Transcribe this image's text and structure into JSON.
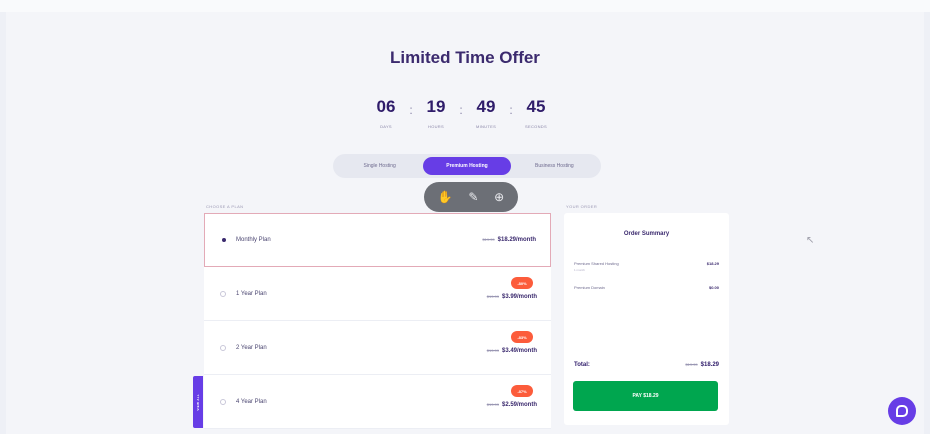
{
  "header": {
    "title": "Limited Time Offer"
  },
  "timer": {
    "blocks": [
      {
        "value": "06",
        "label": "DAYS"
      },
      {
        "value": "19",
        "label": "HOURS"
      },
      {
        "value": "49",
        "label": "MINUTES"
      },
      {
        "value": "45",
        "label": "SECONDS"
      }
    ],
    "separator": ":"
  },
  "tabs": [
    {
      "label": "Single Hosting",
      "active": false
    },
    {
      "label": "Premium Hosting",
      "active": true
    },
    {
      "label": "Business Hosting",
      "active": false
    }
  ],
  "widget": {
    "icons": [
      "hand-icon",
      "magic-wand-icon",
      "settings-circle-icon"
    ],
    "glyphs": [
      "✋",
      "✎",
      "⊕"
    ]
  },
  "plans_section": {
    "label": "CHOOSE A PLAN",
    "plans": [
      {
        "name": "Monthly Plan",
        "old_price": "$19.99",
        "price": "$18.29/month",
        "badge": "",
        "selected": true
      },
      {
        "name": "1 Year Plan",
        "old_price": "$19.99",
        "price": "$3.99/month",
        "badge": "-80%",
        "selected": false
      },
      {
        "name": "2 Year Plan",
        "old_price": "$19.99",
        "price": "$3.49/month",
        "badge": "-83%",
        "selected": false
      },
      {
        "name": "4 Year Plan",
        "old_price": "$19.99",
        "price": "$2.59/month",
        "badge": "-87%",
        "selected": false
      }
    ]
  },
  "summary": {
    "section_label": "YOUR ORDER",
    "title": "Order Summary",
    "rows": [
      {
        "label": "Premium Shared Hosting",
        "sub": "1 month",
        "value": "$18.29"
      },
      {
        "label": "Premium Domain",
        "sub": "",
        "value": "$0.00"
      }
    ],
    "total_label": "Total:",
    "total_old": "$19.99",
    "total": "$18.29",
    "pay_label": "PAY $18.29"
  },
  "side_tab": {
    "label": "VIEW ALL"
  },
  "colors": {
    "accent": "#673de6",
    "pay": "#00a64f",
    "badge": "#fc5c3b",
    "selected_border": "#e3aab7"
  }
}
